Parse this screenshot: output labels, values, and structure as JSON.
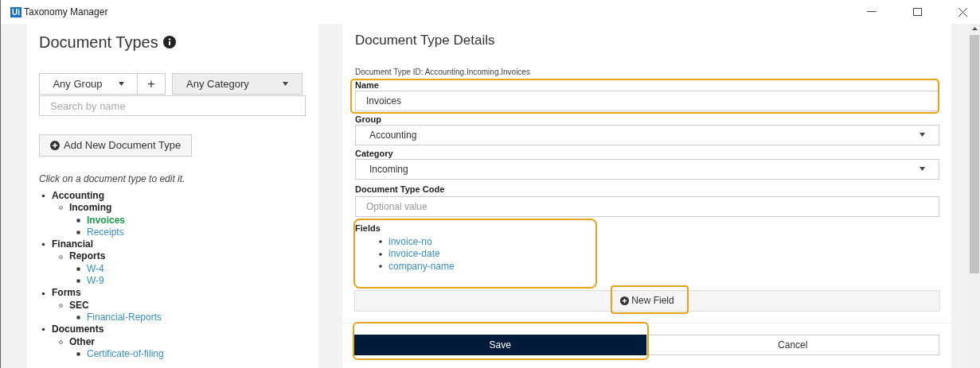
{
  "window": {
    "title": "Taxonomy Manager",
    "logo": "Ui"
  },
  "document_types": {
    "title": "Document Types",
    "group_filter": "Any Group",
    "add_group": "+",
    "category_filter": "Any Category",
    "search": {
      "placeholder": "Search by name"
    },
    "add_button": "Add New Document Type",
    "hint": "Click on a document type to edit it.",
    "tree": [
      {
        "label": "Accounting",
        "children": [
          {
            "label": "Incoming",
            "children": [
              {
                "label": "Invoices",
                "selected": true
              },
              {
                "label": "Receipts",
                "selected": false
              }
            ]
          }
        ]
      },
      {
        "label": "Financial",
        "children": [
          {
            "label": "Reports",
            "children": [
              {
                "label": "W-4",
                "selected": false
              },
              {
                "label": "W-9",
                "selected": false
              }
            ]
          }
        ]
      },
      {
        "label": "Forms",
        "children": [
          {
            "label": "SEC",
            "children": [
              {
                "label": "Financial-Reports",
                "selected": false
              }
            ]
          }
        ]
      },
      {
        "label": "Documents",
        "children": [
          {
            "label": "Other",
            "children": [
              {
                "label": "Certificate-of-filing",
                "selected": false
              }
            ]
          }
        ]
      }
    ]
  },
  "details": {
    "title": "Document Type Details",
    "id_line": "Document Type ID: Accounting.Incoming.Invoices",
    "name": {
      "label": "Name",
      "value": "Invoices",
      "highlighted": true
    },
    "group": {
      "label": "Group",
      "value": "Accounting"
    },
    "category": {
      "label": "Category",
      "value": "Incoming"
    },
    "code": {
      "label": "Document Type Code",
      "placeholder": "Optional value"
    },
    "fields": {
      "label": "Fields",
      "items": [
        "invoice-no",
        "invoice-date",
        "company-name"
      ],
      "highlighted": true
    },
    "new_field": {
      "label": "New Field",
      "highlighted": true
    },
    "save": {
      "label": "Save",
      "highlighted": true
    },
    "cancel": {
      "label": "Cancel",
      "highlighted": false
    }
  }
}
